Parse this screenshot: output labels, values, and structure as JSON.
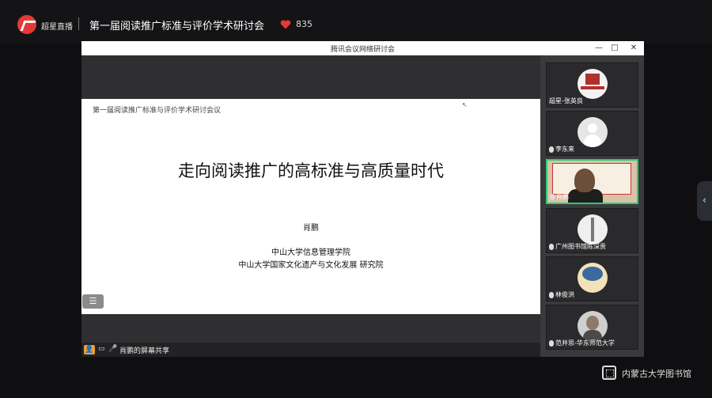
{
  "header": {
    "brand": "超星直播",
    "title": "第一届阅读推广标准与评价学术研讨会",
    "likes": "835",
    "heart_color": "#e53935"
  },
  "meeting_window": {
    "title": "腾讯会议网络研讨会",
    "min_label": "—",
    "restore_label": "□",
    "close_label": "✕"
  },
  "slide": {
    "header": "第一届阅读推广标准与评价学术研讨会议",
    "main_title": "走向阅读推广的高标准与高质量时代",
    "author": "肖鹏",
    "affiliation_1": "中山大学信息管理学院",
    "affiliation_2": "中山大学国家文化遗产与文化发展 研究院"
  },
  "statusbar": {
    "share_text": "肖鹏的屏幕共享"
  },
  "participants": [
    {
      "name": "超星-张英良",
      "icon": "library-logo-avatar"
    },
    {
      "name": "李东来",
      "icon": "default-user-avatar"
    },
    {
      "name": "肖鹏",
      "icon": "live-video",
      "active": true
    },
    {
      "name": "广州图书馆陈深贵",
      "icon": "tower-avatar"
    },
    {
      "name": "林俊洪",
      "icon": "moon-avatar"
    },
    {
      "name": "范并思-华东师范大学",
      "icon": "photo-avatar"
    }
  ],
  "watermark": "内蒙古大学图书馆",
  "colors": {
    "active_border": "#2ecc71",
    "cam_badge": "#f0a030"
  }
}
